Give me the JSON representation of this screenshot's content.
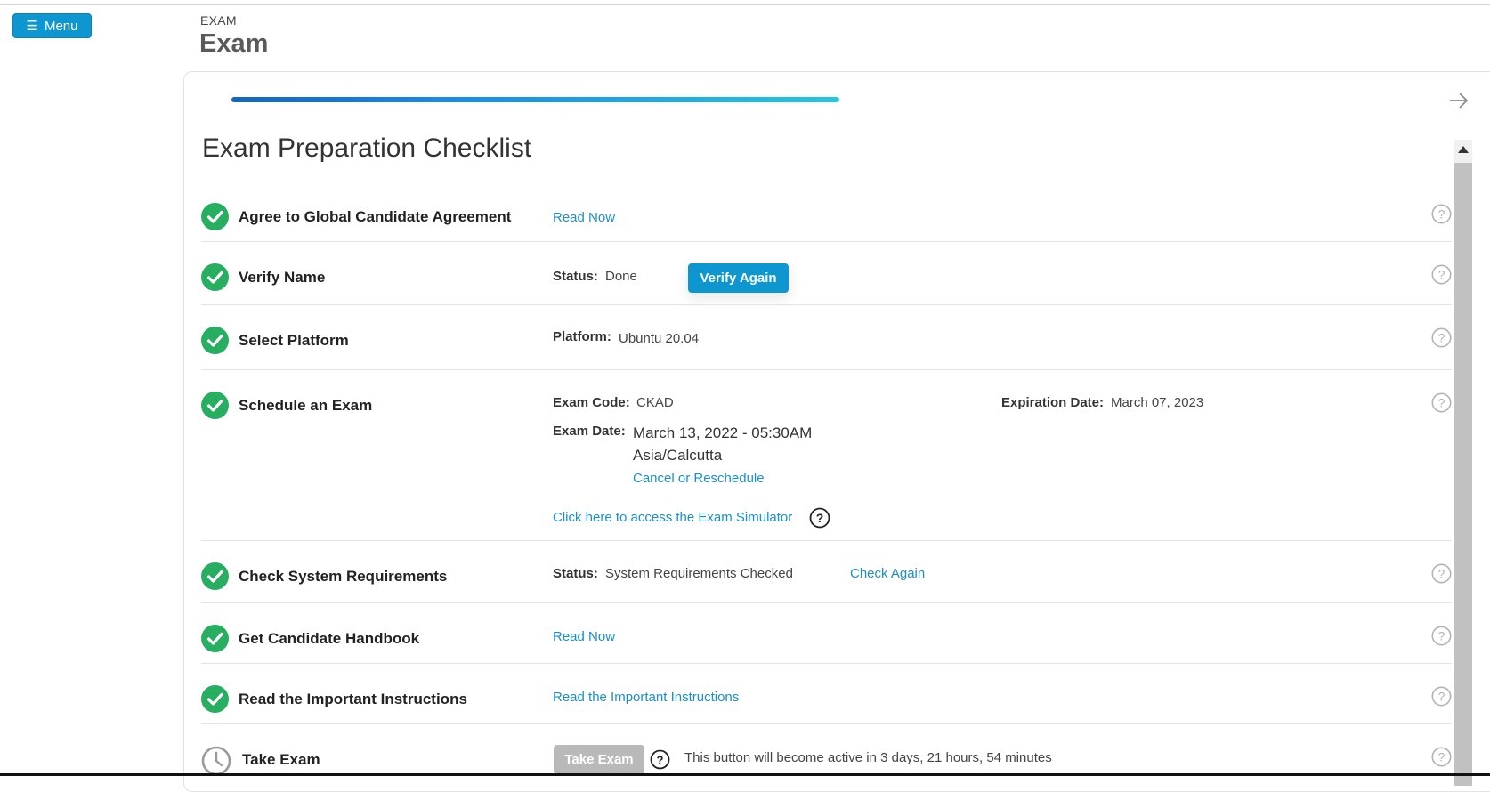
{
  "menu": {
    "label": "Menu",
    "icon": "hamburger-icon"
  },
  "header": {
    "eyebrow": "EXAM",
    "title": "Exam"
  },
  "progress": {
    "fraction": 0.45,
    "colors": [
      "#1565c0",
      "#26c6da"
    ]
  },
  "checklist": {
    "title": "Exam Preparation Checklist",
    "items": [
      {
        "label": "Agree to Global Candidate Agreement",
        "link": "Read Now"
      },
      {
        "label": "Verify Name",
        "status_key": "Status:",
        "status_value": "Done",
        "button": "Verify Again"
      },
      {
        "label": "Select Platform",
        "platform_key": "Platform:",
        "platform_value": "Ubuntu 20.04"
      },
      {
        "label": "Schedule an Exam",
        "code_key": "Exam Code:",
        "code_value": "CKAD",
        "expiration_key": "Expiration Date:",
        "expiration_value": "March 07, 2023",
        "date_key": "Exam Date:",
        "date_value": "March 13, 2022 - 05:30AM",
        "timezone": "Asia/Calcutta",
        "reschedule_link": "Cancel or Reschedule",
        "simulator_link": "Click here to access the Exam Simulator"
      },
      {
        "label": "Check System Requirements",
        "status_key": "Status:",
        "status_value": "System Requirements Checked",
        "link": "Check Again"
      },
      {
        "label": "Get Candidate Handbook",
        "link": "Read Now"
      },
      {
        "label": "Read the Important Instructions",
        "link": "Read the Important Instructions"
      },
      {
        "label": "Take Exam",
        "button": "Take Exam",
        "note": "This button will become active in 3 days, 21 hours, 54 minutes"
      }
    ]
  },
  "colors": {
    "accent": "#0d96d0",
    "check": "#27ae60",
    "link": "#1a8fc8",
    "disabled": "#b9b9b9"
  }
}
